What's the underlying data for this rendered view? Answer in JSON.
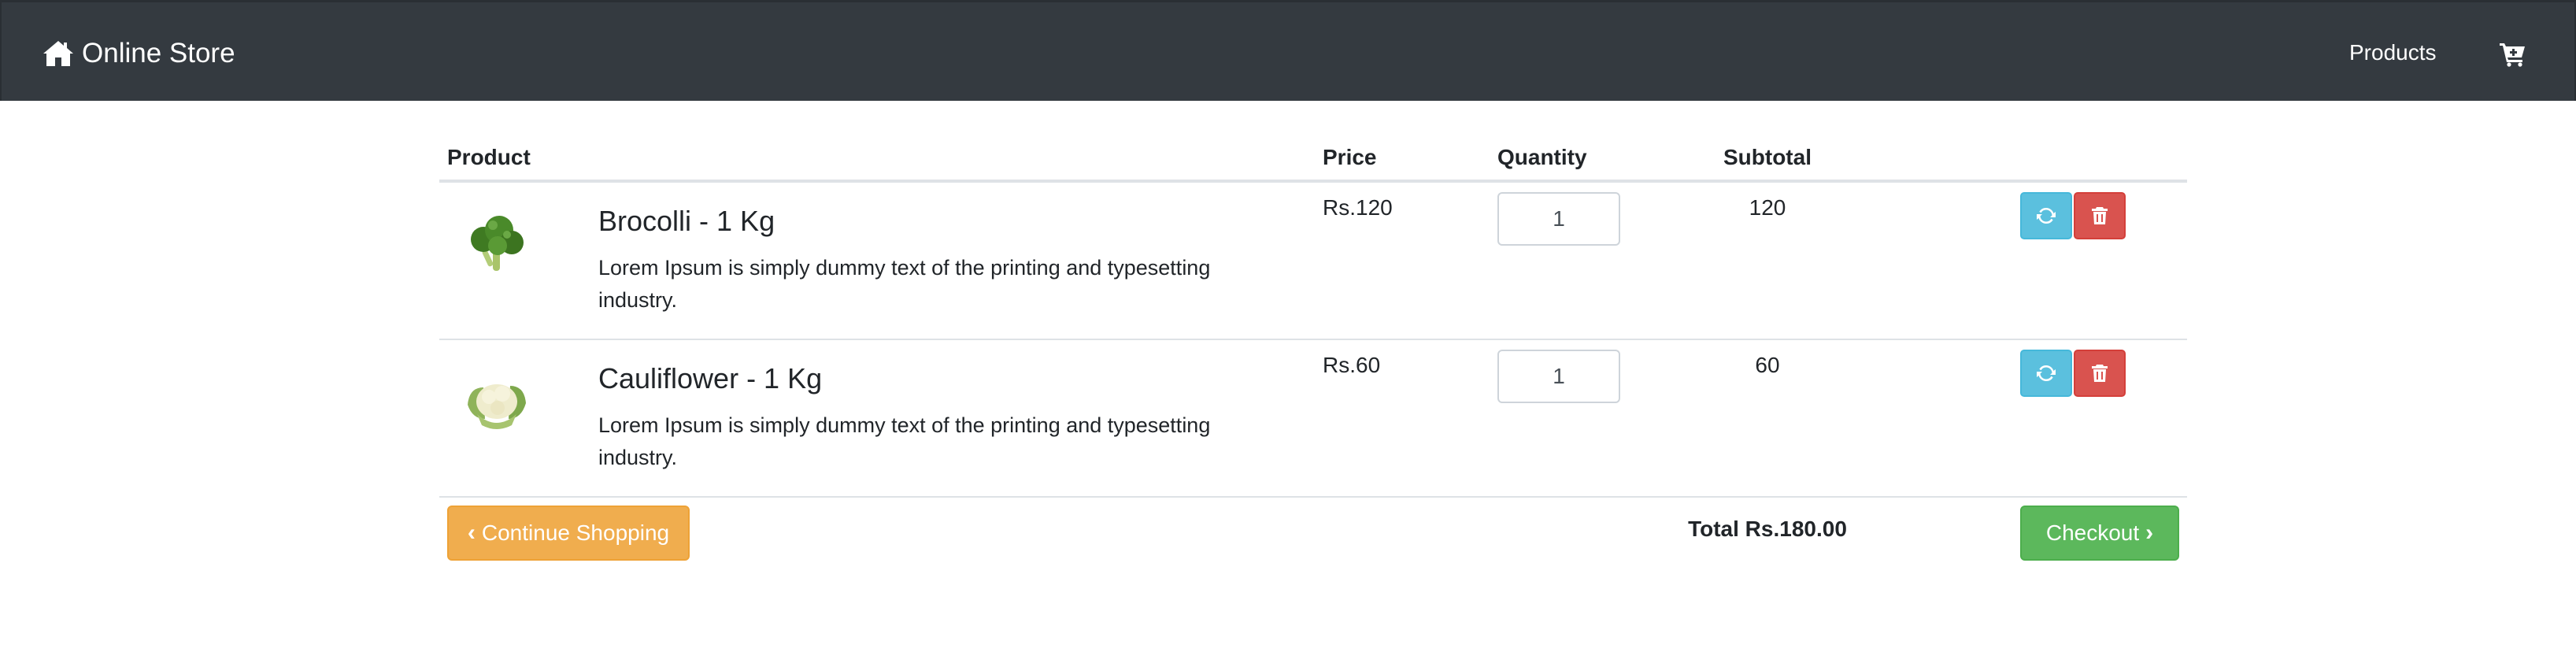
{
  "navbar": {
    "brand": "Online Store",
    "brand_icon": "home-icon",
    "products_link": "Products",
    "cart_icon": "cart-icon",
    "background": "#343a40"
  },
  "table": {
    "headers": {
      "product": "Product",
      "price": "Price",
      "quantity": "Quantity",
      "subtotal": "Subtotal"
    },
    "rows": [
      {
        "name": "Brocolli - 1 Kg",
        "description": "Lorem Ipsum is simply dummy text of the printing and typesetting industry.",
        "price": "Rs.120",
        "quantity": "1",
        "subtotal": "120",
        "image_icon": "broccoli-image"
      },
      {
        "name": "Cauliflower - 1 Kg",
        "description": "Lorem Ipsum is simply dummy text of the printing and typesetting industry.",
        "price": "Rs.60",
        "quantity": "1",
        "subtotal": "60",
        "image_icon": "cauliflower-image"
      }
    ]
  },
  "footer": {
    "continue_label": "Continue Shopping",
    "total": "Total Rs.180.00",
    "checkout_label": "Checkout"
  },
  "colors": {
    "refresh": "#5bc0de",
    "delete": "#d9534f",
    "continue": "#f0ad4e",
    "checkout": "#5cb85c"
  }
}
